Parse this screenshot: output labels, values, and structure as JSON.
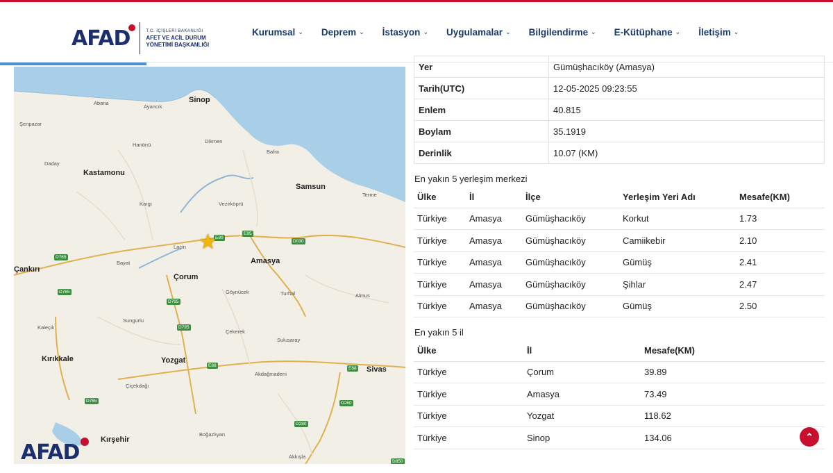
{
  "header": {
    "logo_word": "AFAD",
    "logo_line1": "T.C. İÇİŞLERİ BAKANLIĞI",
    "logo_line2": "AFET VE ACİL DURUM",
    "logo_line3": "YÖNETİMİ BAŞKANLIĞI",
    "nav": [
      {
        "label": "Kurumsal"
      },
      {
        "label": "Deprem"
      },
      {
        "label": "İstasyon"
      },
      {
        "label": "Uygulamalar"
      },
      {
        "label": "Bilgilendirme"
      },
      {
        "label": "E-Kütüphane"
      },
      {
        "label": "İletişim"
      }
    ],
    "accent": "#c8102e",
    "brand": "#1b2f6e"
  },
  "map": {
    "watermark": "AFAD",
    "cities": [
      "Sinop",
      "Kastamonu",
      "Samsun",
      "Amasya",
      "Çorum",
      "Çankırı",
      "Yozgat",
      "Kırıkkale",
      "Sivas",
      "Kırşehir"
    ],
    "towns": [
      "Abana",
      "Ayancık",
      "Şenpazar",
      "Hanönü",
      "Dikmen",
      "Bafra",
      "Daday",
      "Vezirköprü",
      "Kargı",
      "Terme",
      "Laçin",
      "Bayat",
      "Göynücek",
      "Turhal",
      "Almus",
      "Sungurlu",
      "Çekerek",
      "Sulusaray",
      "Kaleçik",
      "Çiçekdağı",
      "Akdağmadeni",
      "Boğazlıyan",
      "Akkışla"
    ],
    "roads": [
      "E80",
      "E95",
      "D030",
      "D765",
      "D795",
      "D795",
      "E88",
      "E88",
      "D260",
      "D765",
      "D280",
      "D850",
      "D765"
    ],
    "epicenter_icon": "star-icon"
  },
  "params": [
    {
      "key": "Yer",
      "value": "Gümüşhacıköy (Amasya)"
    },
    {
      "key": "Tarih(UTC)",
      "value": "12-05-2025 09:23:55"
    },
    {
      "key": "Enlem",
      "value": "40.815"
    },
    {
      "key": "Boylam",
      "value": "35.1919"
    },
    {
      "key": "Derinlik",
      "value": "10.07 (KM)"
    }
  ],
  "settlements": {
    "title": "En yakın 5 yerleşim merkezi",
    "headers": [
      "Ülke",
      "İl",
      "İlçe",
      "Yerleşim Yeri Adı",
      "Mesafe(KM)"
    ],
    "rows": [
      [
        "Türkiye",
        "Amasya",
        "Gümüşhacıköy",
        "Korkut",
        "1.73"
      ],
      [
        "Türkiye",
        "Amasya",
        "Gümüşhacıköy",
        "Camiikebir",
        "2.10"
      ],
      [
        "Türkiye",
        "Amasya",
        "Gümüşhacıköy",
        "Gümüş",
        "2.41"
      ],
      [
        "Türkiye",
        "Amasya",
        "Gümüşhacıköy",
        "Şihlar",
        "2.47"
      ],
      [
        "Türkiye",
        "Amasya",
        "Gümüşhacıköy",
        "Gümüş",
        "2.50"
      ]
    ]
  },
  "provinces": {
    "title": "En yakın 5 il",
    "headers": [
      "Ülke",
      "İl",
      "Mesafe(KM)"
    ],
    "rows": [
      [
        "Türkiye",
        "Çorum",
        "39.89"
      ],
      [
        "Türkiye",
        "Amasya",
        "73.49"
      ],
      [
        "Türkiye",
        "Yozgat",
        "118.62"
      ],
      [
        "Türkiye",
        "Sinop",
        "134.06"
      ]
    ]
  },
  "scroll_top_icon": "chevron-up-icon"
}
